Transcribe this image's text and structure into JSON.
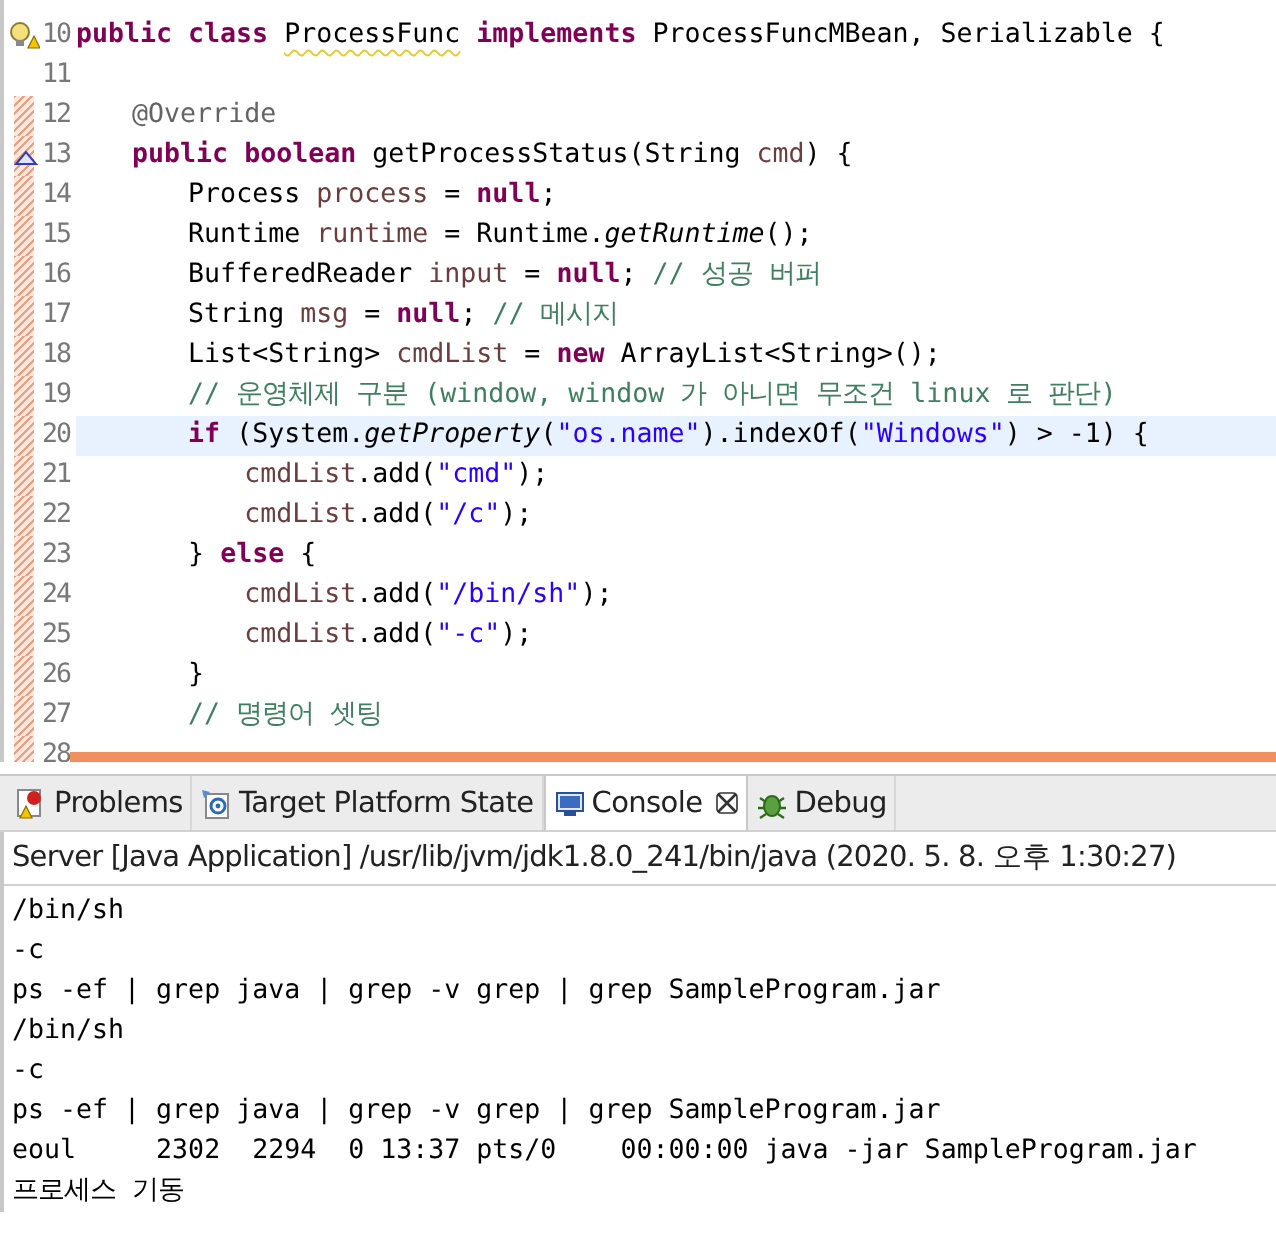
{
  "editor": {
    "lines": [
      {
        "number": "10",
        "warning": true,
        "override": false,
        "changed": false,
        "current": false,
        "tokens": [
          {
            "text": "public class ",
            "kind": "keyword"
          },
          {
            "text": "ProcessFunc",
            "kind": "warned"
          },
          {
            "text": " implements",
            "kind": "keyword"
          },
          {
            "text": " ProcessFuncMBean, Serializable {",
            "kind": "plain"
          }
        ]
      },
      {
        "number": "11",
        "warning": false,
        "override": false,
        "changed": false,
        "current": false
      },
      {
        "number": "12",
        "warning": false,
        "override": false,
        "changed": true,
        "current": false,
        "tokens": [
          {
            "text": "\t@Override",
            "kind": "annotation"
          }
        ]
      },
      {
        "number": "13",
        "warning": false,
        "override": true,
        "changed": true,
        "current": false,
        "tokens": [
          {
            "text": "\tpublic boolean",
            "kind": "keyword"
          },
          {
            "text": " getProcessStatus(String ",
            "kind": "plain"
          },
          {
            "text": "cmd",
            "kind": "variable"
          },
          {
            "text": ") {",
            "kind": "plain"
          }
        ]
      },
      {
        "number": "14",
        "warning": false,
        "override": false,
        "changed": true,
        "current": false,
        "tokens": [
          {
            "text": "\t\tProcess ",
            "kind": "plain"
          },
          {
            "text": "process",
            "kind": "variable"
          },
          {
            "text": " = ",
            "kind": "plain"
          },
          {
            "text": "null",
            "kind": "keyword"
          },
          {
            "text": ";",
            "kind": "plain"
          }
        ]
      },
      {
        "number": "15",
        "warning": false,
        "override": false,
        "changed": true,
        "current": false,
        "tokens": [
          {
            "text": "\t\tRuntime ",
            "kind": "plain"
          },
          {
            "text": "runtime",
            "kind": "variable"
          },
          {
            "text": " = Runtime.",
            "kind": "plain"
          },
          {
            "text": "getRuntime",
            "kind": "static"
          },
          {
            "text": "();",
            "kind": "plain"
          }
        ]
      },
      {
        "number": "16",
        "warning": false,
        "override": false,
        "changed": true,
        "current": false,
        "tokens": [
          {
            "text": "\t\tBufferedReader ",
            "kind": "plain"
          },
          {
            "text": "input",
            "kind": "variable"
          },
          {
            "text": " = ",
            "kind": "plain"
          },
          {
            "text": "null",
            "kind": "keyword"
          },
          {
            "text": "; ",
            "kind": "plain"
          },
          {
            "text": "// 성공 버퍼",
            "kind": "comment"
          }
        ]
      },
      {
        "number": "17",
        "warning": false,
        "override": false,
        "changed": true,
        "current": false,
        "tokens": [
          {
            "text": "\t\tString ",
            "kind": "plain"
          },
          {
            "text": "msg",
            "kind": "variable"
          },
          {
            "text": " = ",
            "kind": "plain"
          },
          {
            "text": "null",
            "kind": "keyword"
          },
          {
            "text": "; ",
            "kind": "plain"
          },
          {
            "text": "// 메시지",
            "kind": "comment"
          }
        ]
      },
      {
        "number": "18",
        "warning": false,
        "override": false,
        "changed": true,
        "current": false,
        "tokens": [
          {
            "text": "\t\tList<String> ",
            "kind": "plain"
          },
          {
            "text": "cmdList",
            "kind": "variable"
          },
          {
            "text": " = ",
            "kind": "plain"
          },
          {
            "text": "new",
            "kind": "keyword"
          },
          {
            "text": " ArrayList<String>();",
            "kind": "plain"
          }
        ]
      },
      {
        "number": "19",
        "warning": false,
        "override": false,
        "changed": true,
        "current": false,
        "tokens": [
          {
            "text": "\t\t// 운영체제 구분 (window, window 가 아니면 무조건 linux 로 판단)",
            "kind": "comment"
          }
        ]
      },
      {
        "number": "20",
        "warning": false,
        "override": false,
        "changed": true,
        "current": true,
        "tokens": [
          {
            "text": "\t\tif",
            "kind": "keyword"
          },
          {
            "text": " (System.",
            "kind": "plain"
          },
          {
            "text": "getProperty",
            "kind": "static"
          },
          {
            "text": "(",
            "kind": "plain"
          },
          {
            "text": "\"os.name\"",
            "kind": "string"
          },
          {
            "text": ").indexOf(",
            "kind": "plain"
          },
          {
            "text": "\"Windows\"",
            "kind": "string"
          },
          {
            "text": ") > -1) {",
            "kind": "plain"
          }
        ]
      },
      {
        "number": "21",
        "warning": false,
        "override": false,
        "changed": true,
        "current": false,
        "tokens": [
          {
            "text": "\t\t\tcmdList",
            "kind": "variable"
          },
          {
            "text": ".add(",
            "kind": "plain"
          },
          {
            "text": "\"cmd\"",
            "kind": "string"
          },
          {
            "text": ");",
            "kind": "plain"
          }
        ]
      },
      {
        "number": "22",
        "warning": false,
        "override": false,
        "changed": true,
        "current": false,
        "tokens": [
          {
            "text": "\t\t\tcmdList",
            "kind": "variable"
          },
          {
            "text": ".add(",
            "kind": "plain"
          },
          {
            "text": "\"/c\"",
            "kind": "string"
          },
          {
            "text": ");",
            "kind": "plain"
          }
        ]
      },
      {
        "number": "23",
        "warning": false,
        "override": false,
        "changed": true,
        "current": false,
        "tokens": [
          {
            "text": "\t\t} ",
            "kind": "plain"
          },
          {
            "text": "else",
            "kind": "keyword"
          },
          {
            "text": " {",
            "kind": "plain"
          }
        ]
      },
      {
        "number": "24",
        "warning": false,
        "override": false,
        "changed": true,
        "current": false,
        "tokens": [
          {
            "text": "\t\t\tcmdList",
            "kind": "variable"
          },
          {
            "text": ".add(",
            "kind": "plain"
          },
          {
            "text": "\"/bin/sh\"",
            "kind": "string"
          },
          {
            "text": ");",
            "kind": "plain"
          }
        ]
      },
      {
        "number": "25",
        "warning": false,
        "override": false,
        "changed": true,
        "current": false,
        "tokens": [
          {
            "text": "\t\t\tcmdList",
            "kind": "variable"
          },
          {
            "text": ".add(",
            "kind": "plain"
          },
          {
            "text": "\"-c\"",
            "kind": "string"
          },
          {
            "text": ");",
            "kind": "plain"
          }
        ]
      },
      {
        "number": "26",
        "warning": false,
        "override": false,
        "changed": true,
        "current": false,
        "tokens": [
          {
            "text": "\t\t}",
            "kind": "plain"
          }
        ]
      },
      {
        "number": "27",
        "warning": false,
        "override": false,
        "changed": true,
        "current": false,
        "tokens": [
          {
            "text": "\t\t// 명령어 셋팅",
            "kind": "comment"
          }
        ]
      },
      {
        "number": "28",
        "warning": false,
        "override": false,
        "changed": true,
        "current": false
      }
    ]
  },
  "tabs": [
    {
      "label": "Problems",
      "selected": false
    },
    {
      "label": "Target Platform State",
      "selected": false
    },
    {
      "label": "Console",
      "selected": true
    },
    {
      "label": "Debug",
      "selected": false
    }
  ],
  "console": {
    "title": "Server [Java Application] /usr/lib/jvm/jdk1.8.0_241/bin/java (2020. 5. 8. 오후 1:30:27)",
    "lines": [
      "/bin/sh",
      "-c",
      "ps -ef | grep java | grep -v grep | grep SampleProgram.jar",
      "/bin/sh",
      "-c",
      "ps -ef | grep java | grep -v grep | grep SampleProgram.jar",
      "eoul     2302  2294  0 13:37 pts/0    00:00:00 java -jar SampleProgram.jar",
      "프로세스 기동"
    ]
  }
}
